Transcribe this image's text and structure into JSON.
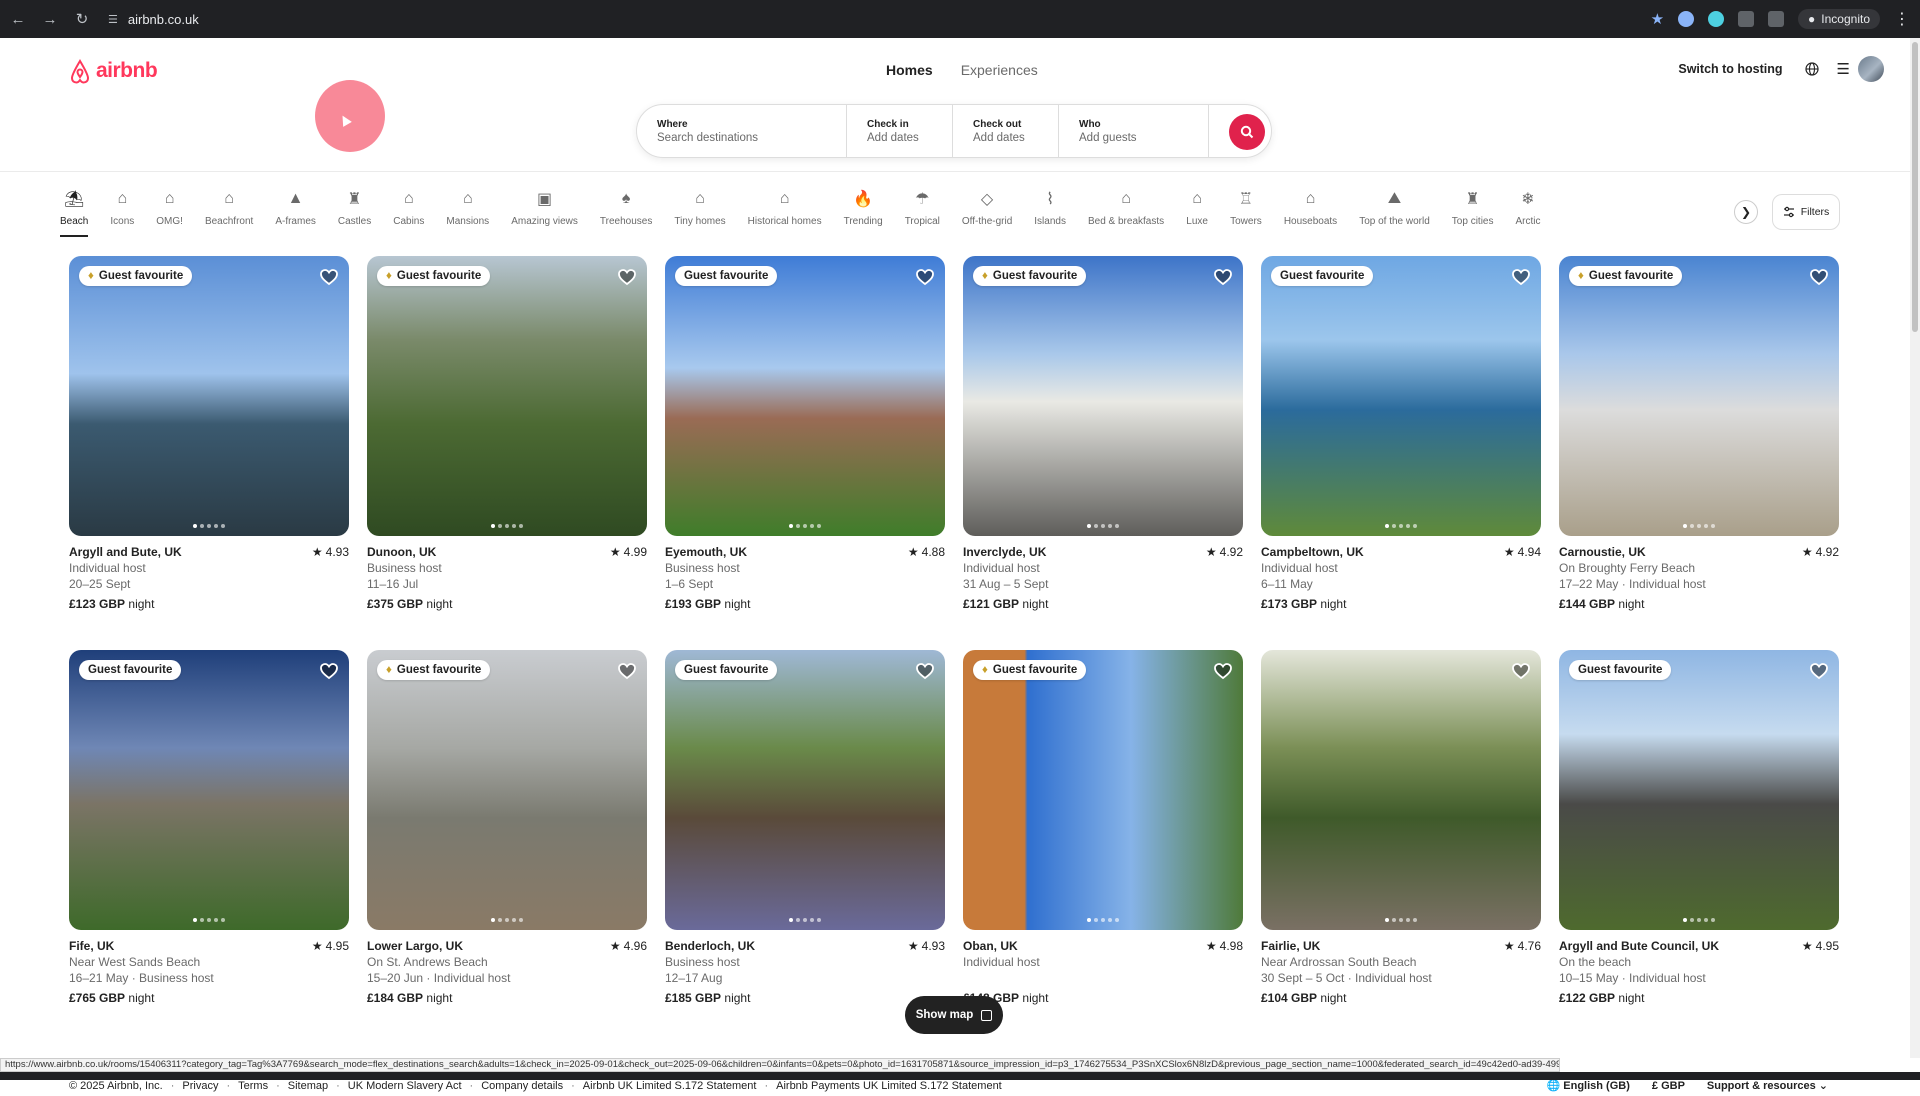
{
  "browser": {
    "url": "airbnb.co.uk",
    "profile": "Incognito",
    "status_url": "https://www.airbnb.co.uk/rooms/15406311?category_tag=Tag%3A7769&search_mode=flex_destinations_search&adults=1&check_in=2025-09-01&check_out=2025-09-06&children=0&infants=0&pets=0&photo_id=1631705871&source_impression_id=p3_1746275534_P3SnXCSlox6N8lzD&previous_page_section_name=1000&federated_search_id=49c42ed0-ad39-499c-abb6-6f415159674e"
  },
  "header": {
    "logo_text": "airbnb",
    "tabs": [
      "Homes",
      "Experiences"
    ],
    "switch_to_hosting": "Switch to hosting"
  },
  "search": {
    "where_label": "Where",
    "where_placeholder": "Search destinations",
    "checkin_label": "Check in",
    "checkin_value": "Add dates",
    "checkout_label": "Check out",
    "checkout_value": "Add dates",
    "who_label": "Who",
    "who_value": "Add guests"
  },
  "categories": [
    "Beach",
    "Icons",
    "OMG!",
    "Beachfront",
    "A-frames",
    "Castles",
    "Cabins",
    "Mansions",
    "Amazing views",
    "Treehouses",
    "Tiny homes",
    "Historical homes",
    "Trending",
    "Tropical",
    "Off-the-grid",
    "Islands",
    "Bed & breakfasts",
    "Luxe",
    "Towers",
    "Houseboats",
    "Top of the world",
    "Top cities",
    "Arctic"
  ],
  "filters_label": "Filters",
  "listings": [
    {
      "location": "Argyll and Bute, UK",
      "rating": "4.93",
      "line1": "Individual host",
      "line2": "20–25 Sept",
      "price": "£123 GBP",
      "per": "night",
      "badge": "Guest favourite",
      "trophy": true
    },
    {
      "location": "Dunoon, UK",
      "rating": "4.99",
      "line1": "Business host",
      "line2": "11–16 Jul",
      "price": "£375 GBP",
      "per": "night",
      "badge": "Guest favourite",
      "trophy": true
    },
    {
      "location": "Eyemouth, UK",
      "rating": "4.88",
      "line1": "Business host",
      "line2": "1–6 Sept",
      "price": "£193 GBP",
      "per": "night",
      "badge": "Guest favourite",
      "trophy": false
    },
    {
      "location": "Inverclyde, UK",
      "rating": "4.92",
      "line1": "Individual host",
      "line2": "31 Aug – 5 Sept",
      "price": "£121 GBP",
      "per": "night",
      "badge": "Guest favourite",
      "trophy": true
    },
    {
      "location": "Campbeltown, UK",
      "rating": "4.94",
      "line1": "Individual host",
      "line2": "6–11 May",
      "price": "£173 GBP",
      "per": "night",
      "badge": "Guest favourite",
      "trophy": false
    },
    {
      "location": "Carnoustie, UK",
      "rating": "4.92",
      "line1": "On Broughty Ferry Beach",
      "line2": "17–22 May · Individual host",
      "price": "£144 GBP",
      "per": "night",
      "badge": "Guest favourite",
      "trophy": true
    },
    {
      "location": "Fife, UK",
      "rating": "4.95",
      "line1": "Near West Sands Beach",
      "line2": "16–21 May · Business host",
      "price": "£765 GBP",
      "per": "night",
      "badge": "Guest favourite",
      "trophy": false
    },
    {
      "location": "Lower Largo, UK",
      "rating": "4.96",
      "line1": "On St. Andrews Beach",
      "line2": "15–20 Jun · Individual host",
      "price": "£184 GBP",
      "per": "night",
      "badge": "Guest favourite",
      "trophy": true
    },
    {
      "location": "Benderloch, UK",
      "rating": "4.93",
      "line1": "Business host",
      "line2": "12–17 Aug",
      "price": "£185 GBP",
      "per": "night",
      "badge": "Guest favourite",
      "trophy": false
    },
    {
      "location": "Oban, UK",
      "rating": "4.98",
      "line1": "Individual host",
      "line2": "",
      "price": "£148 GBP",
      "per": "night",
      "badge": "Guest favourite",
      "trophy": true
    },
    {
      "location": "Fairlie, UK",
      "rating": "4.76",
      "line1": "Near Ardrossan South Beach",
      "line2": "30 Sept – 5 Oct · Individual host",
      "price": "£104 GBP",
      "per": "night",
      "badge": "",
      "trophy": false
    },
    {
      "location": "Argyll and Bute Council, UK",
      "rating": "4.95",
      "line1": "On the beach",
      "line2": "10–15 May · Individual host",
      "price": "£122 GBP",
      "per": "night",
      "badge": "Guest favourite",
      "trophy": false
    }
  ],
  "show_map_label": "Show map",
  "footer": {
    "links": [
      "© 2025 Airbnb, Inc.",
      "Privacy",
      "Terms",
      "Sitemap",
      "UK Modern Slavery Act",
      "Company details",
      "Airbnb UK Limited S.172 Statement",
      "Airbnb Payments UK Limited S.172 Statement"
    ],
    "language": "English (GB)",
    "currency": "£ GBP",
    "support": "Support & resources"
  },
  "colors": {
    "brand": "#ff385c",
    "search_button": "#e0224c"
  }
}
